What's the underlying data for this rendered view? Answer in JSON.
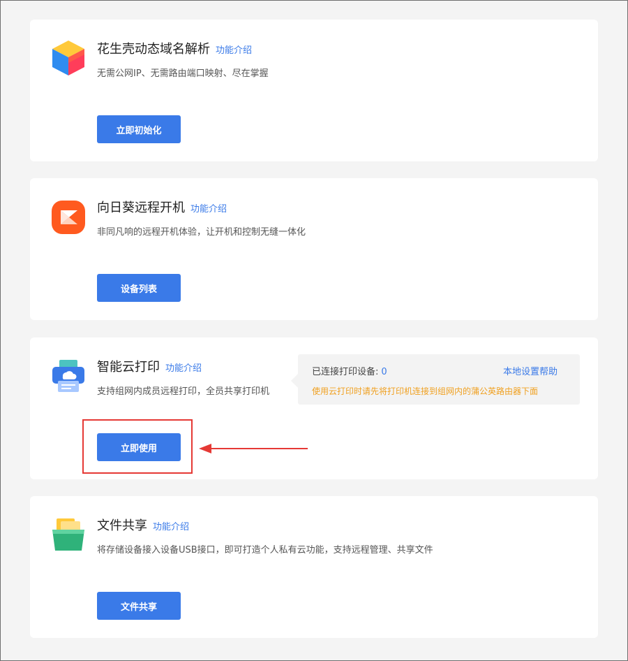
{
  "intro_link_label": "功能介绍",
  "cards": [
    {
      "title": "花生壳动态域名解析",
      "description": "无需公网IP、无需路由端口映射、尽在掌握",
      "button_label": "立即初始化",
      "icon": "cube-icon"
    },
    {
      "title": "向日葵远程开机",
      "description": "非同凡响的远程开机体验，让开机和控制无缝一体化",
      "button_label": "设备列表",
      "icon": "sunflower-power-icon"
    },
    {
      "title": "智能云打印",
      "description": "支持组网内成员远程打印，全员共享打印机",
      "button_label": "立即使用",
      "icon": "cloud-printer-icon",
      "info": {
        "connected_label": "已连接打印设备:",
        "connected_count": "0",
        "help_link": "本地设置帮助",
        "tip": "使用云打印时请先将打印机连接到组网内的蒲公英路由器下面"
      }
    },
    {
      "title": "文件共享",
      "description": "将存储设备接入设备USB接口，即可打造个人私有云功能，支持远程管理、共享文件",
      "button_label": "文件共享",
      "icon": "folder-icon"
    }
  ],
  "colors": {
    "accent": "#3a7ae8",
    "warning": "#f0a020",
    "highlight": "#e53935"
  }
}
